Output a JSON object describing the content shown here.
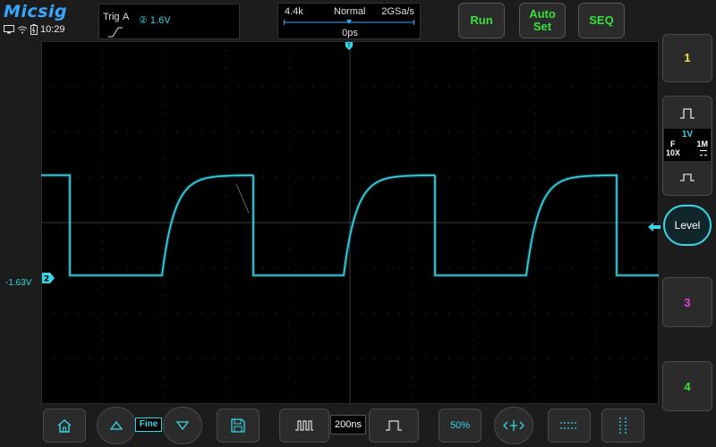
{
  "brand": {
    "logo": "Micsig"
  },
  "status": {
    "time": "10:29"
  },
  "trigger": {
    "label": "Trig",
    "source": "A",
    "channel_level": "② 1.6V"
  },
  "timebase": {
    "memory_depth": "4.4k",
    "mode": "Normal",
    "sample_rate": "2GSa/s",
    "position": "0ps",
    "scale": "200ns"
  },
  "buttons": {
    "run": "Run",
    "auto_set_line1": "Auto",
    "auto_set_line2": "Set",
    "seq": "SEQ",
    "level": "Level",
    "fine": "Fine",
    "fifty_percent": "50%"
  },
  "channels": {
    "ch1": {
      "label": "1",
      "color": "#f5e64a"
    },
    "ch2": {
      "scale": "1V",
      "coupling_f": "F",
      "impedance": "1M",
      "probe": "10X",
      "marker": "2",
      "offset_label": "-1.63V",
      "color": "#36d6e6"
    },
    "ch3": {
      "label": "3",
      "color": "#e040e0"
    },
    "ch4": {
      "label": "4",
      "color": "#39e039"
    }
  },
  "icons": [
    "home-icon",
    "arrow-up-icon",
    "arrow-down-icon",
    "save-icon",
    "zoom-out-pulse-icon",
    "zoom-in-pulse-icon",
    "percent-icon",
    "offset-reset-icon",
    "horizontal-cursor-icon",
    "vertical-cursor-icon",
    "screen-icon",
    "wifi-icon",
    "battery-icon"
  ]
}
